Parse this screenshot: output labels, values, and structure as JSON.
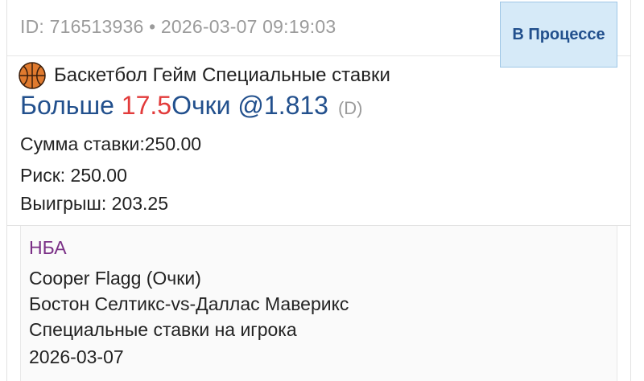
{
  "bet": {
    "header": "ID: 716513936 • 2026-03-07 09:19:03",
    "status": "В Процессе",
    "sport_icon": "basketball-icon",
    "sport_line": "Баскетбол Гейм Специальные ставки",
    "selection": {
      "side": "Больше",
      "line": "17.5",
      "market_odds": "Очки @1.813",
      "odds_type": "(D)"
    },
    "stake": "Сумма ставки:250.00",
    "risk": "Риск: 250.00",
    "win": "Выигрыш: 203.25",
    "details": {
      "league": "НБА",
      "player": "Cooper Flagg (Очки)",
      "match": "Бостон Селтикс-vs-Даллас Маверикс",
      "market": "Специальные ставки на игрока",
      "date": "2026-03-07"
    }
  },
  "colors": {
    "accent_blue": "#22508d",
    "line_red": "#e23b3b",
    "league_purple": "#7a2f86",
    "badge_bg": "#d6eaf8"
  }
}
